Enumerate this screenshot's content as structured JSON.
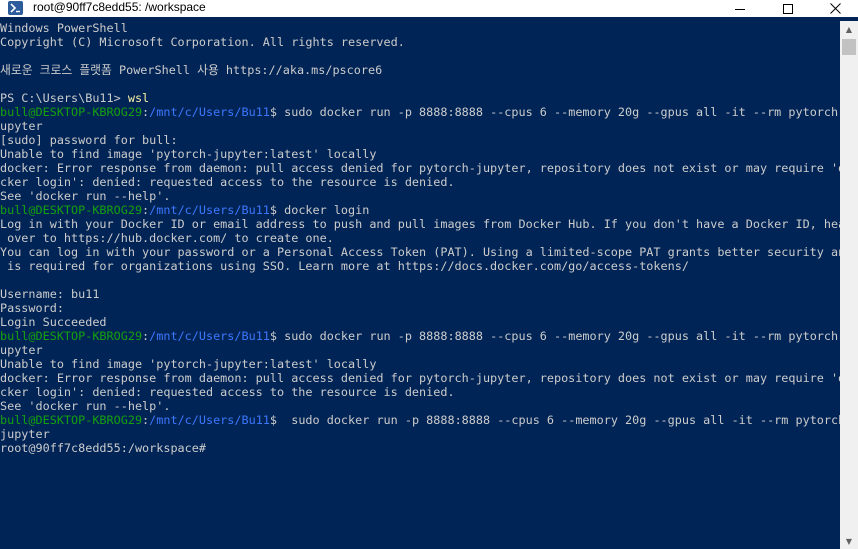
{
  "window": {
    "title": "root@90ff7c8edd55: /workspace",
    "icon": "powershell-icon",
    "minimize_icon": "minimize-icon",
    "maximize_icon": "maximize-icon",
    "close_icon": "close-icon"
  },
  "colors": {
    "background": "#012456",
    "text": "#cccccc",
    "prompt_user": "#13a10e",
    "prompt_path": "#3b78ff"
  },
  "terminal": {
    "l1": "Windows PowerShell",
    "l2": "Copyright (C) Microsoft Corporation. All rights reserved.",
    "l3": "새로운 크로스 플랫폼 PowerShell 사용 https://aka.ms/pscore6",
    "ps_prompt": "PS C:\\Users\\Bu11> ",
    "ps_cmd": "wsl",
    "user_host": "bull@DESKTOP-KBROG29",
    "colon": ":",
    "path": "/mnt/c/Users/Bu11",
    "dollar": "$",
    "c1a": " sudo docker run -p 8888:8888 --cpus 6 --memory 20g --gpus all -it --rm pytorch-j",
    "c1b": "upyter",
    "o1": "[sudo] password for bull:",
    "o2": "Unable to find image 'pytorch-jupyter:latest' locally",
    "o3": "docker: Error response from daemon: pull access denied for pytorch-jupyter, repository does not exist or may require 'do",
    "o4": "cker login': denied: requested access to the resource is denied.",
    "o5": "See 'docker run --help'.",
    "c2": " docker login",
    "d1": "Log in with your Docker ID or email address to push and pull images from Docker Hub. If you don't have a Docker ID, head",
    "d2": " over to https://hub.docker.com/ to create one.",
    "d3": "You can log in with your password or a Personal Access Token (PAT). Using a limited-scope PAT grants better security and",
    "d4": " is required for organizations using SSO. Learn more at https://docs.docker.com/go/access-tokens/",
    "u1": "Username: bu11",
    "u2": "Password:",
    "u3": "Login Succeeded",
    "c3a": " sudo docker run -p 8888:8888 --cpus 6 --memory 20g --gpus all -it --rm pytorch-j",
    "c3b": "upyter",
    "e1": "Unable to find image 'pytorch-jupyter:latest' locally",
    "e2": "docker: Error response from daemon: pull access denied for pytorch-jupyter, repository does not exist or may require 'do",
    "e3": "cker login': denied: requested access to the resource is denied.",
    "e4": "See 'docker run --help'.",
    "c4a": "  sudo docker run -p 8888:8888 --cpus 6 --memory 20g --gpus all -it --rm pytorch-",
    "c4b": "jupyter",
    "final": "root@90ff7c8edd55:/workspace#"
  }
}
